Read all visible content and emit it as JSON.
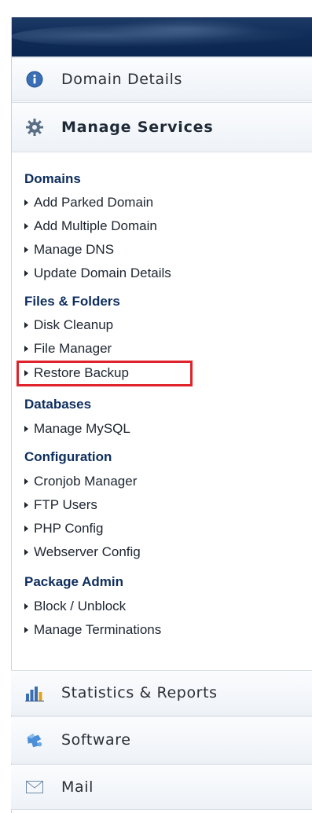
{
  "nav": {
    "domain_details": "Domain Details",
    "manage_services": "Manage Services",
    "statistics_reports": "Statistics & Reports",
    "software": "Software",
    "mail": "Mail"
  },
  "groups": [
    {
      "title": "Domains",
      "links": [
        "Add Parked Domain",
        "Add Multiple Domain",
        "Manage DNS",
        "Update Domain Details"
      ]
    },
    {
      "title": "Files & Folders",
      "links": [
        "Disk Cleanup",
        "File Manager",
        "Restore Backup"
      ]
    },
    {
      "title": "Databases",
      "links": [
        "Manage MySQL"
      ]
    },
    {
      "title": "Configuration",
      "links": [
        "Cronjob Manager",
        "FTP Users",
        "PHP Config",
        "Webserver Config"
      ]
    },
    {
      "title": "Package Admin",
      "links": [
        "Block / Unblock",
        "Manage Terminations"
      ]
    }
  ],
  "highlighted_link": "Restore Backup",
  "colors": {
    "header": "#0f2d58",
    "group_title": "#0d2d5e",
    "highlight": "#e0232b"
  }
}
